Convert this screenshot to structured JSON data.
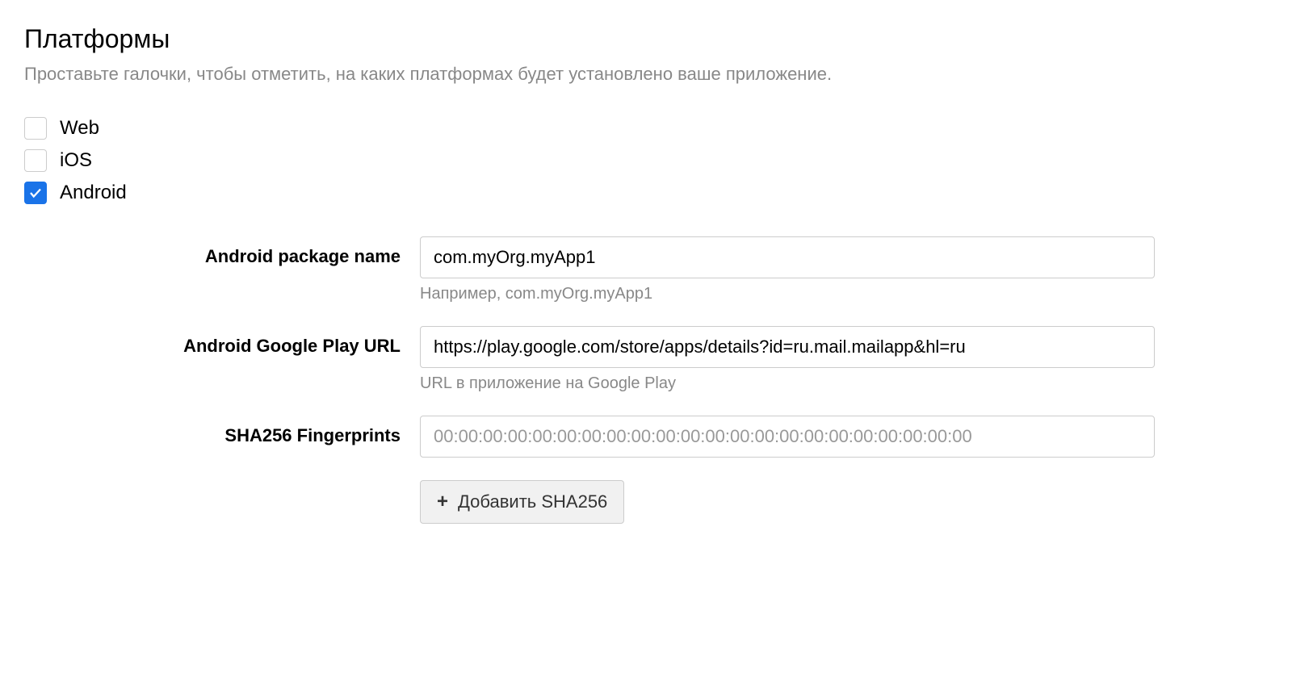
{
  "title": "Платформы",
  "subtitle": "Проставьте галочки, чтобы отметить, на каких платформах будет установлено ваше приложение.",
  "platforms": {
    "web": {
      "label": "Web",
      "checked": false
    },
    "ios": {
      "label": "iOS",
      "checked": false
    },
    "android": {
      "label": "Android",
      "checked": true
    }
  },
  "fields": {
    "packageName": {
      "label": "Android package name",
      "value": "com.myOrg.myApp1",
      "hint": "Например, com.myOrg.myApp1"
    },
    "playUrl": {
      "label": "Android Google Play URL",
      "value": "https://play.google.com/store/apps/details?id=ru.mail.mailapp&hl=ru",
      "hint": "URL в приложение на Google Play"
    },
    "sha256": {
      "label": "SHA256 Fingerprints",
      "placeholder": "00:00:00:00:00:00:00:00:00:00:00:00:00:00:00:00:00:00:00:00:00:00",
      "value": ""
    }
  },
  "addButton": {
    "label": "Добавить SHA256"
  }
}
